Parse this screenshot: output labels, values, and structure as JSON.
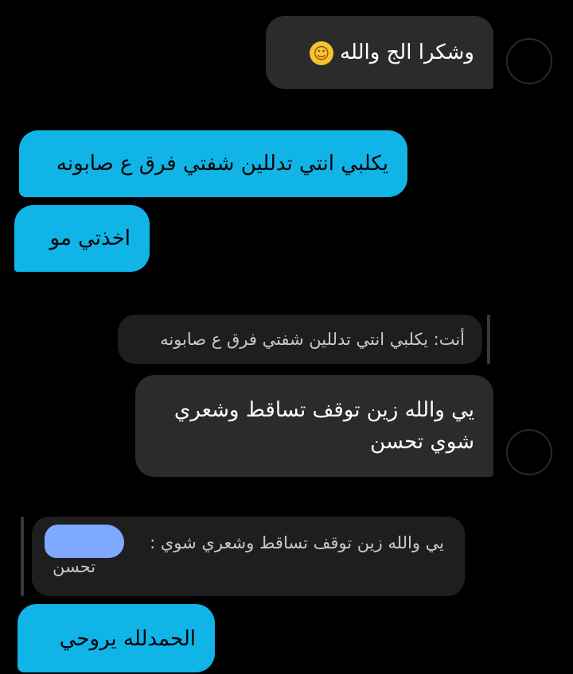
{
  "messages": {
    "m1": {
      "text": "وشكرا الج والله",
      "emoji": "☺"
    },
    "m2": {
      "text": "يكلبي انتي تدللين شفتي فرق ع صابونه"
    },
    "m3": {
      "text": "اخذتي مو"
    },
    "reply1": {
      "text": "أنت: يكلبي انتي تدللين شفتي فرق ع صابونه"
    },
    "m4": {
      "line1": "يي والله زين توقف تساقط وشعري",
      "line2": "شوي تحسن"
    },
    "reply2": {
      "line1": "يي والله زين توقف تساقط وشعري شوي :",
      "line2": "تحسن"
    },
    "m5": {
      "text": "الحمدلله يروحي"
    }
  },
  "colors": {
    "background": "#000000",
    "incoming_bubble": "#2b2b2b",
    "outgoing_bubble": "#10b4e6",
    "reply_bubble": "#1e1e1e"
  }
}
